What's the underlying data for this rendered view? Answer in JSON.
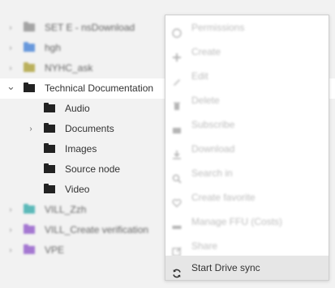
{
  "tree": {
    "rows": [
      {
        "label": "SET E - nsDownload",
        "arrow": "›",
        "color": "#8a8a8a",
        "level": 0,
        "blurred": true
      },
      {
        "label": "hgh",
        "arrow": "›",
        "color": "#3a7bd5",
        "level": 0,
        "blurred": true
      },
      {
        "label": "NYHC_ask",
        "arrow": "›",
        "color": "#a89a2a",
        "level": 0,
        "blurred": true
      },
      {
        "label": "Technical Documentation",
        "arrow": "⌄",
        "color": "#222222",
        "level": 0,
        "blurred": false,
        "selected": true
      },
      {
        "label": "Audio",
        "arrow": "",
        "color": "#222222",
        "level": 1,
        "blurred": false
      },
      {
        "label": "Documents",
        "arrow": "›",
        "color": "#222222",
        "level": 1,
        "blurred": false
      },
      {
        "label": "Images",
        "arrow": "",
        "color": "#222222",
        "level": 1,
        "blurred": false
      },
      {
        "label": "Source node",
        "arrow": "",
        "color": "#222222",
        "level": 1,
        "blurred": false
      },
      {
        "label": "Video",
        "arrow": "",
        "color": "#222222",
        "level": 1,
        "blurred": false
      },
      {
        "label": "VILL_Zzh",
        "arrow": "›",
        "color": "#2aa6a6",
        "level": 0,
        "blurred": true
      },
      {
        "label": "VILL_Create verification",
        "arrow": "›",
        "color": "#8a4fc7",
        "level": 0,
        "blurred": true
      },
      {
        "label": "VPE",
        "arrow": "›",
        "color": "#8a4fc7",
        "level": 0,
        "blurred": true
      }
    ]
  },
  "menu": {
    "items": [
      {
        "label": "Permissions",
        "icon": "permissions-icon"
      },
      {
        "label": "Create",
        "icon": "plus-icon"
      },
      {
        "label": "Edit",
        "icon": "pencil-icon"
      },
      {
        "label": "Delete",
        "icon": "trash-icon"
      },
      {
        "label": "Subscribe",
        "icon": "subscribe-icon"
      },
      {
        "label": "Download",
        "icon": "download-icon"
      },
      {
        "label": "Search in",
        "icon": "search-icon"
      },
      {
        "label": "Create favorite",
        "icon": "heart-icon"
      },
      {
        "label": "Manage FFU (Costs)",
        "icon": "manage-icon"
      },
      {
        "label": "Share",
        "icon": "share-icon"
      }
    ],
    "active_item": {
      "label": "Start Drive sync",
      "icon": "sync-icon"
    }
  }
}
